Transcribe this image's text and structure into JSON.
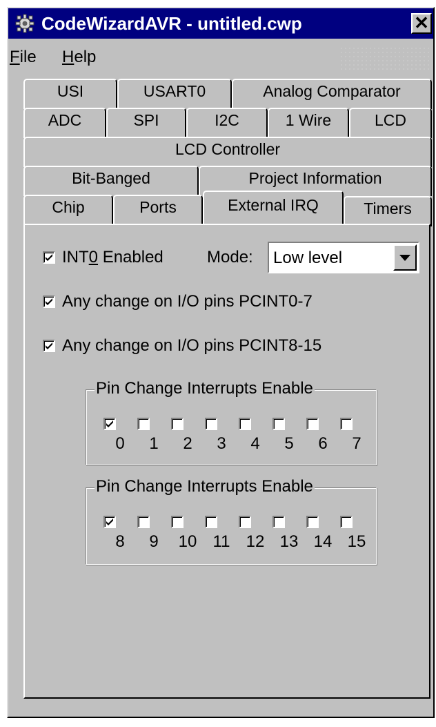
{
  "window": {
    "title": "CodeWizardAVR - untitled.cwp",
    "close_glyph": "✕",
    "app_icon": "gear-icon"
  },
  "menu": {
    "file": {
      "accel": "F",
      "rest": "ile"
    },
    "help": {
      "accel": "H",
      "rest": "elp"
    }
  },
  "tabs": {
    "row1": [
      "USI",
      "USART0",
      "Analog Comparator"
    ],
    "row2": [
      "ADC",
      "SPI",
      "I2C",
      "1 Wire",
      "LCD"
    ],
    "row3": [
      "LCD Controller"
    ],
    "row4": [
      "Bit-Banged",
      "Project Information"
    ],
    "row5": [
      "Chip",
      "Ports",
      "External IRQ",
      "Timers"
    ],
    "active": "External IRQ"
  },
  "external_irq": {
    "int0": {
      "pre": "INT",
      "accel": "0",
      "post": " Enabled",
      "checked": true
    },
    "mode_label": "Mode:",
    "mode_value": "Low level",
    "pcint0_7": {
      "label": "Any change on I/O pins PCINT0-7",
      "checked": true
    },
    "pcint8_15": {
      "label": "Any change on I/O pins PCINT8-15",
      "checked": true
    },
    "group1": {
      "title": "Pin Change Interrupts Enable",
      "pins": [
        {
          "num": "0",
          "checked": true
        },
        {
          "num": "1",
          "checked": false
        },
        {
          "num": "2",
          "checked": false
        },
        {
          "num": "3",
          "checked": false
        },
        {
          "num": "4",
          "checked": false
        },
        {
          "num": "5",
          "checked": false
        },
        {
          "num": "6",
          "checked": false
        },
        {
          "num": "7",
          "checked": false
        }
      ]
    },
    "group2": {
      "title": "Pin Change Interrupts Enable",
      "pins": [
        {
          "num": "8",
          "checked": true
        },
        {
          "num": "9",
          "checked": false
        },
        {
          "num": "10",
          "checked": false
        },
        {
          "num": "11",
          "checked": false
        },
        {
          "num": "12",
          "checked": false
        },
        {
          "num": "13",
          "checked": false
        },
        {
          "num": "14",
          "checked": false
        },
        {
          "num": "15",
          "checked": false
        }
      ]
    }
  },
  "colors": {
    "titlebar": "#000080",
    "face": "#c0c0c0"
  }
}
